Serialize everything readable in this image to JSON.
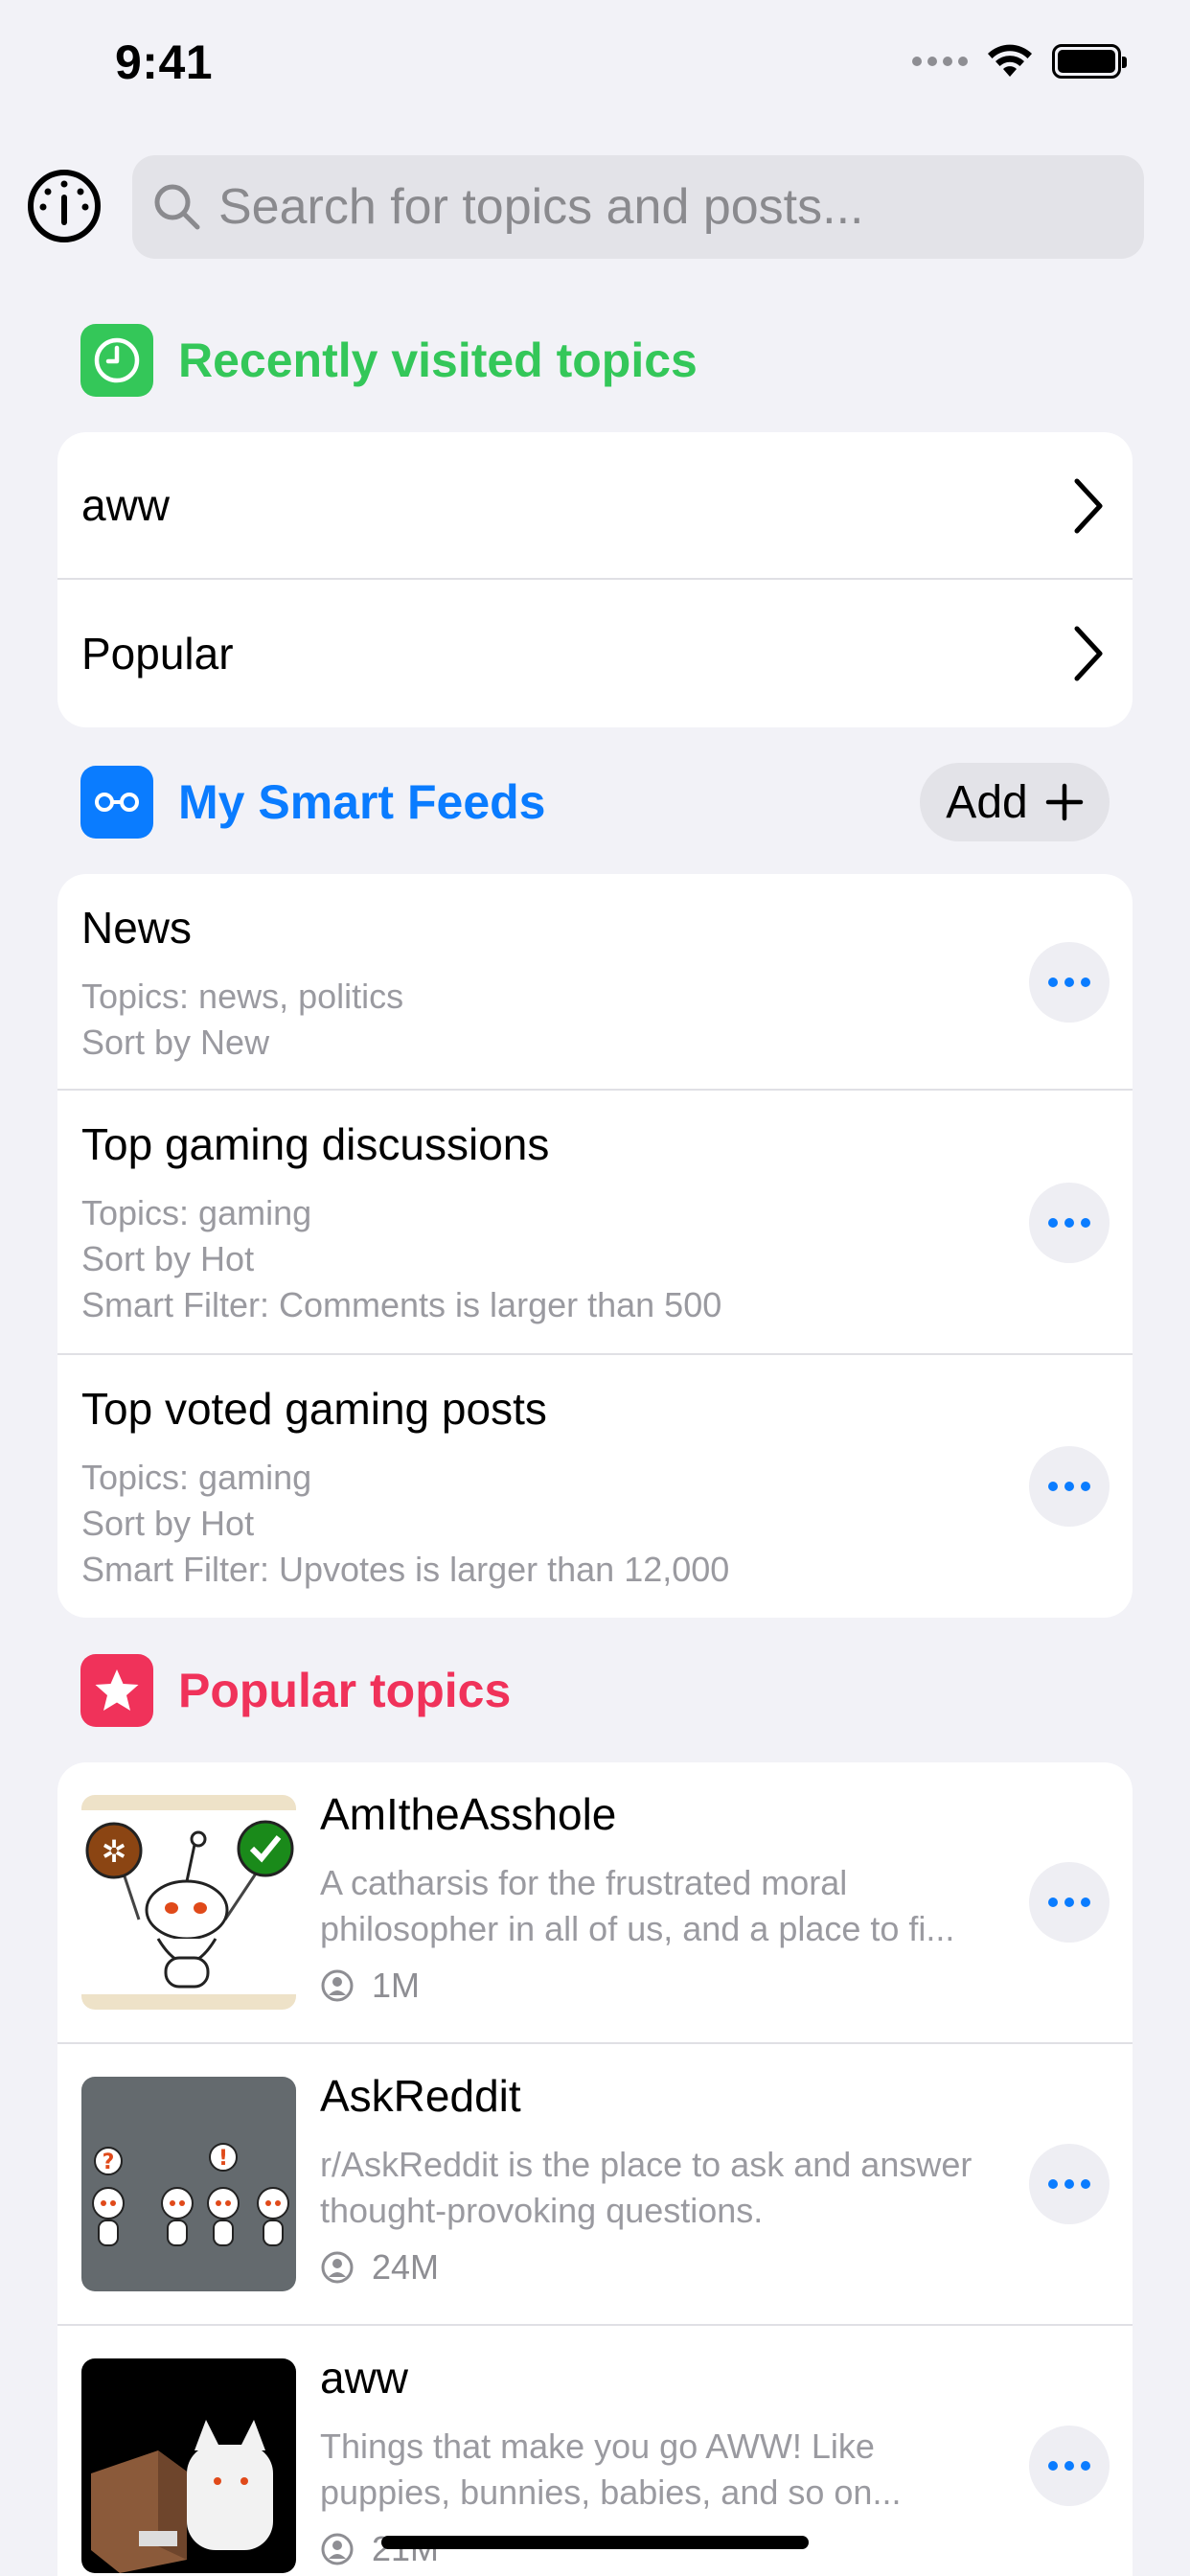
{
  "status_bar": {
    "time": "9:41"
  },
  "search": {
    "placeholder": "Search for topics and posts..."
  },
  "sections": {
    "recent": {
      "title": "Recently visited topics",
      "color": "#34c759"
    },
    "feeds": {
      "title": "My Smart Feeds",
      "color": "#0a7cff",
      "add_label": "Add"
    },
    "popular": {
      "title": "Popular topics",
      "color": "#f0325a"
    }
  },
  "recent_topics": [
    {
      "label": "aww"
    },
    {
      "label": "Popular"
    }
  ],
  "smart_feeds": [
    {
      "title": "News",
      "lines": [
        "Topics: news, politics",
        "Sort by New"
      ]
    },
    {
      "title": "Top gaming discussions",
      "lines": [
        "Topics: gaming",
        "Sort by Hot",
        "Smart Filter: Comments is larger than 500"
      ]
    },
    {
      "title": "Top voted gaming posts",
      "lines": [
        "Topics: gaming",
        "Sort by Hot",
        "Smart Filter: Upvotes is larger than 12,000"
      ]
    }
  ],
  "popular_topics": [
    {
      "name": "AmItheAsshole",
      "desc1": "A catharsis for the frustrated moral",
      "desc2": "philosopher in all of us, and a place to fi...",
      "members": "1M"
    },
    {
      "name": "AskReddit",
      "desc1": "r/AskReddit is the place to ask and answer",
      "desc2": "thought-provoking questions.",
      "members": "24M"
    },
    {
      "name": "aww",
      "desc1": "Things that make you go AWW! Like",
      "desc2": "puppies, bunnies, babies, and so on...",
      "members": "21M"
    }
  ]
}
